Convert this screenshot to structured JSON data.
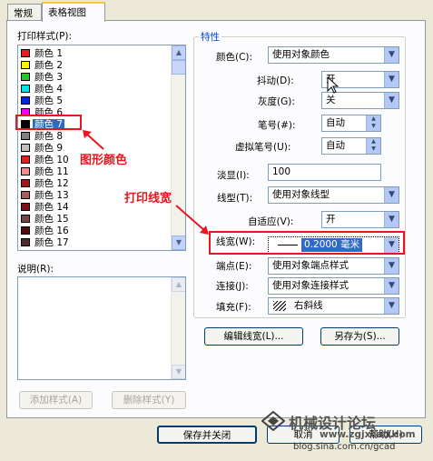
{
  "tabs": [
    {
      "label": "常规",
      "active": false
    },
    {
      "label": "表格视图",
      "active": true
    }
  ],
  "styles_list": {
    "label": "打印样式(P):",
    "items": [
      {
        "label": "颜色 1",
        "color": "#e81c24"
      },
      {
        "label": "颜色 2",
        "color": "#fff200"
      },
      {
        "label": "颜色 3",
        "color": "#22c825"
      },
      {
        "label": "颜色 4",
        "color": "#00e5e8"
      },
      {
        "label": "颜色 5",
        "color": "#0026e8"
      },
      {
        "label": "颜色 6",
        "color": "#f100f1"
      },
      {
        "label": "颜色 7",
        "color": "#000000",
        "selected": true
      },
      {
        "label": "颜色 8",
        "color": "#808080"
      },
      {
        "label": "颜色 9",
        "color": "#c0c0c0"
      },
      {
        "label": "颜色 10",
        "color": "#e81c24"
      },
      {
        "label": "颜色 11",
        "color": "#f28c8c"
      },
      {
        "label": "颜色 12",
        "color": "#a5161b"
      },
      {
        "label": "颜色 13",
        "color": "#a95c5e"
      },
      {
        "label": "颜色 14",
        "color": "#7a1217"
      },
      {
        "label": "颜色 15",
        "color": "#7a4446"
      },
      {
        "label": "颜色 16",
        "color": "#4e0c0f"
      },
      {
        "label": "颜色 17",
        "color": "#4e2c2d"
      }
    ]
  },
  "description": {
    "label": "说明(R):"
  },
  "buttons": {
    "add_style": "添加样式(A)",
    "delete_style": "删除样式(Y)",
    "edit_lineweights": "编辑线宽(L)...",
    "save_as": "另存为(S)...",
    "save_close": "保存并关闭",
    "cancel": "取消",
    "help": "帮助(H)"
  },
  "properties": {
    "title": "特性",
    "color": {
      "label": "颜色(C):",
      "value": "使用对象颜色"
    },
    "dither": {
      "label": "抖动(D):",
      "value": "开"
    },
    "grayscale": {
      "label": "灰度(G):",
      "value": "关"
    },
    "pen": {
      "label": "笔号(#):",
      "value": "自动"
    },
    "virtual_pen": {
      "label": "虚拟笔号(U):",
      "value": "自动"
    },
    "screening": {
      "label": "淡显(I):",
      "value": "100"
    },
    "linetype": {
      "label": "线型(T):",
      "value": "使用对象线型"
    },
    "adaptive": {
      "label": "自适应(V):",
      "value": "开"
    },
    "lineweight": {
      "label": "线宽(W):",
      "value": "0.2000 毫米"
    },
    "line_end": {
      "label": "端点(E):",
      "value": "使用对象端点样式"
    },
    "line_join": {
      "label": "连接(J):",
      "value": "使用对象连接样式"
    },
    "fill": {
      "label": "填充(F):",
      "value": "右斜线"
    }
  },
  "annotations": {
    "graphic_color": "图形颜色",
    "print_lineweight": "打印线宽"
  },
  "watermark": {
    "site_name": "机械设计论坛",
    "site_url": "www.zgjxcad.com",
    "blog": "blog.sina.com.cn/gcad"
  }
}
